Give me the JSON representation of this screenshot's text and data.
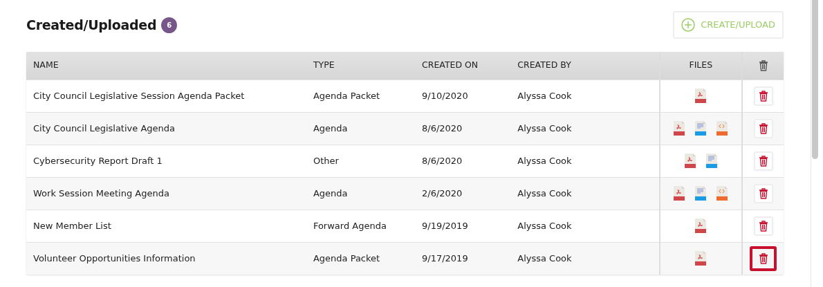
{
  "header": {
    "title": "Created/Uploaded",
    "count": "6",
    "create_button": "CREATE/UPLOAD"
  },
  "table": {
    "columns": [
      "NAME",
      "TYPE",
      "CREATED ON",
      "CREATED BY",
      "FILES"
    ],
    "rows": [
      {
        "name": "City Council Legislative Session Agenda Packet",
        "type": "Agenda Packet",
        "created_on": "9/10/2020",
        "created_by": "Alyssa Cook",
        "files": [
          {
            "kind": "pdf"
          }
        ],
        "focused": false
      },
      {
        "name": "City Council Legislative Agenda",
        "type": "Agenda",
        "created_on": "8/6/2020",
        "created_by": "Alyssa Cook",
        "files": [
          {
            "kind": "pdf"
          },
          {
            "kind": "doc"
          },
          {
            "kind": "code"
          }
        ],
        "focused": false
      },
      {
        "name": "Cybersecurity Report Draft 1",
        "type": "Other",
        "created_on": "8/6/2020",
        "created_by": "Alyssa Cook",
        "files": [
          {
            "kind": "pdf"
          },
          {
            "kind": "doc"
          }
        ],
        "focused": false
      },
      {
        "name": "Work Session Meeting Agenda",
        "type": "Agenda",
        "created_on": "2/6/2020",
        "created_by": "Alyssa Cook",
        "files": [
          {
            "kind": "pdf"
          },
          {
            "kind": "doc"
          },
          {
            "kind": "code"
          }
        ],
        "focused": false
      },
      {
        "name": "New Member List",
        "type": "Forward Agenda",
        "created_on": "9/19/2019",
        "created_by": "Alyssa Cook",
        "files": [
          {
            "kind": "pdf"
          }
        ],
        "focused": false
      },
      {
        "name": "Volunteer Opportunities Information",
        "type": "Agenda Packet",
        "created_on": "9/17/2019",
        "created_by": "Alyssa Cook",
        "files": [
          {
            "kind": "pdf"
          }
        ],
        "focused": true
      }
    ]
  }
}
